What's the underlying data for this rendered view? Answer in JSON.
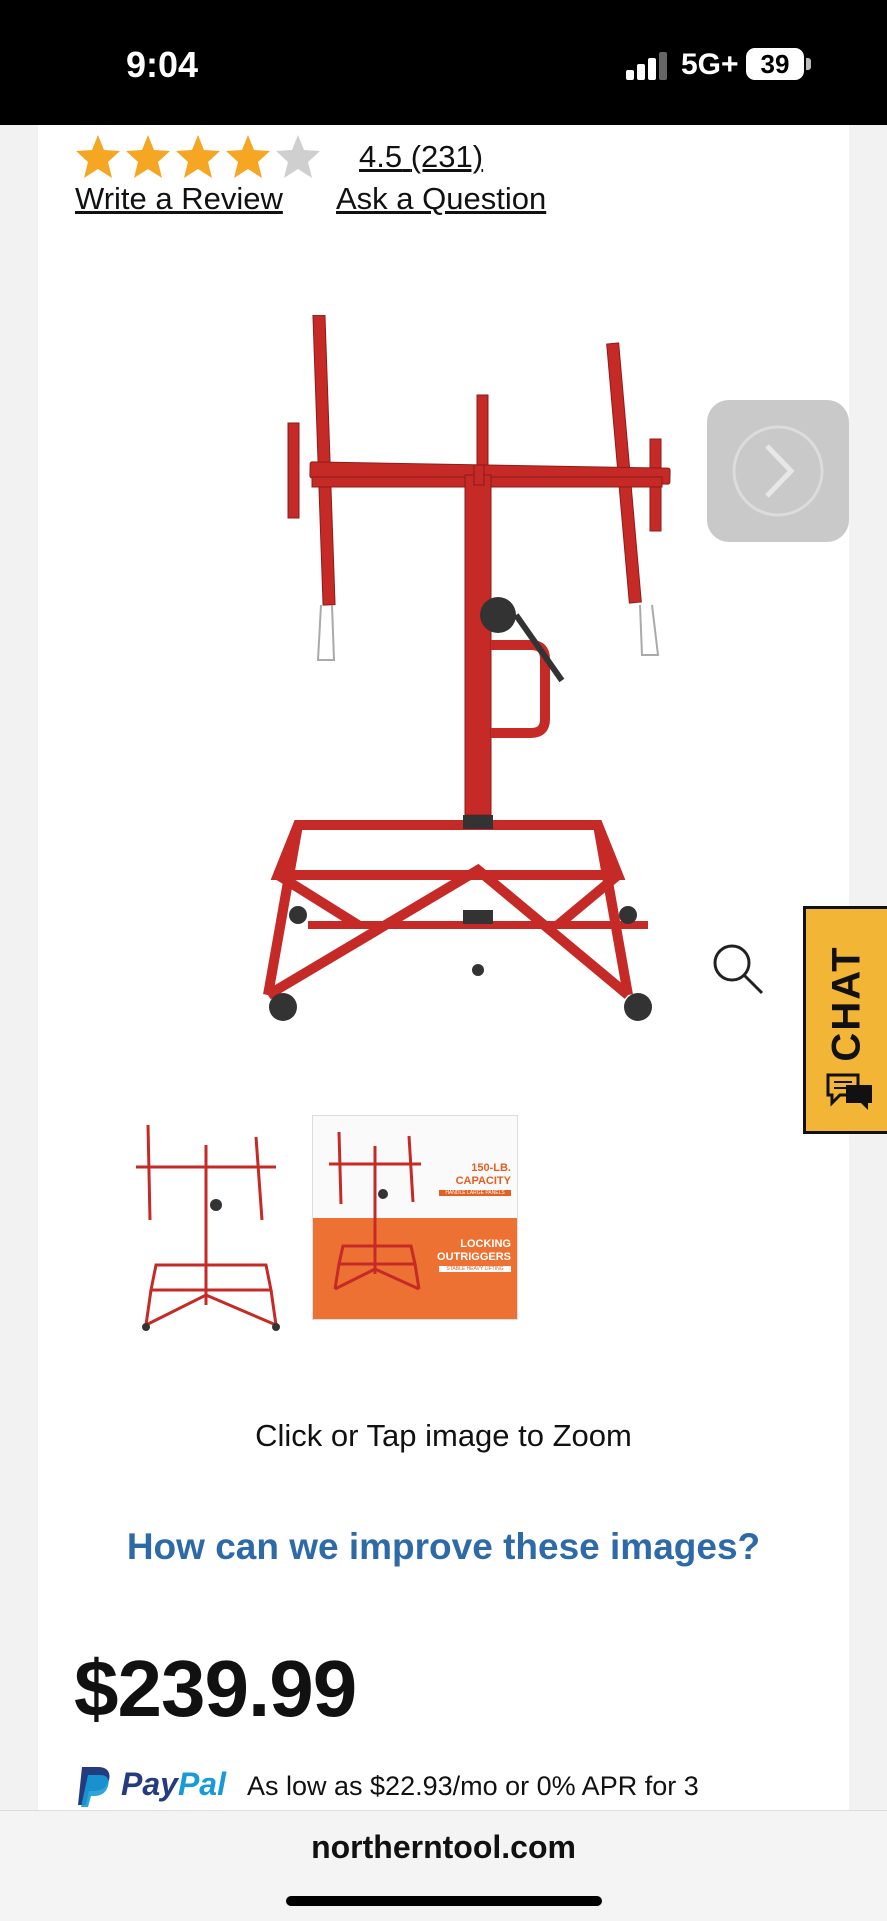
{
  "status_bar": {
    "time": "9:04",
    "network": "5G+",
    "battery": "39"
  },
  "product": {
    "rating_value": "4.5",
    "rating_count": "(231)",
    "stars": 4.5,
    "write_review": "Write a Review",
    "ask_question": "Ask a Question",
    "zoom_hint": "Click or Tap image to Zoom",
    "improve_images": "How can we improve these images?",
    "price": "$239.99"
  },
  "thumbnails": {
    "second": {
      "line1": "150-LB.",
      "line2": "CAPACITY",
      "sub1": "HANDLE LARGE PANELS",
      "line3": "LOCKING",
      "line4": "OUTRIGGERS",
      "sub2": "STABLE HEAVY LIFTING"
    }
  },
  "paypal": {
    "brand_pay": "Pay",
    "brand_pal": "Pal",
    "financing": "As low as $22.93/mo or 0% APR for 3"
  },
  "chat": {
    "label": "CHAT"
  },
  "browser": {
    "domain": "northerntool.com"
  },
  "colors": {
    "accent_blue": "#2e6aa8",
    "star": "#f5a623",
    "chat_bg": "#f2b535",
    "product_red": "#c62a26"
  }
}
